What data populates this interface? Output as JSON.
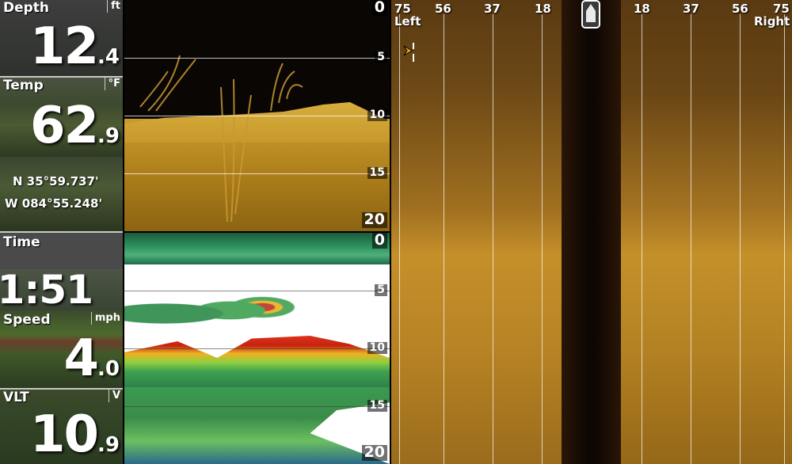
{
  "readouts": {
    "depth": {
      "label": "Depth",
      "unit": "ft",
      "int": "12",
      "dec": ".4"
    },
    "temp": {
      "label": "Temp",
      "unit": "°F",
      "int": "62",
      "dec": ".9"
    },
    "gps": {
      "lat": "N  35°59.737'",
      "lon": "W  084°55.248'"
    },
    "time": {
      "label": "Time",
      "value": "1:51"
    },
    "speed": {
      "label": "Speed",
      "unit": "mph",
      "int": "4",
      "dec": ".0"
    },
    "vlt": {
      "label": "VLT",
      "unit": "V",
      "int": "10",
      "dec": ".9"
    }
  },
  "down_imaging": {
    "depth_ticks": [
      "0",
      "5",
      "10",
      "15",
      "20"
    ]
  },
  "sonar_2d": {
    "depth_ticks": [
      "0",
      "5",
      "10",
      "15",
      "20"
    ]
  },
  "side_imaging": {
    "ranges_left": [
      "75",
      "56",
      "37",
      "18"
    ],
    "ranges_right": [
      "18",
      "37",
      "56",
      "75"
    ],
    "left_label": "Left",
    "right_label": "Right"
  },
  "colors": {
    "si_palette": "#c58f2a",
    "di_palette": "#c99a2e",
    "sonar_red": "#c42410"
  }
}
